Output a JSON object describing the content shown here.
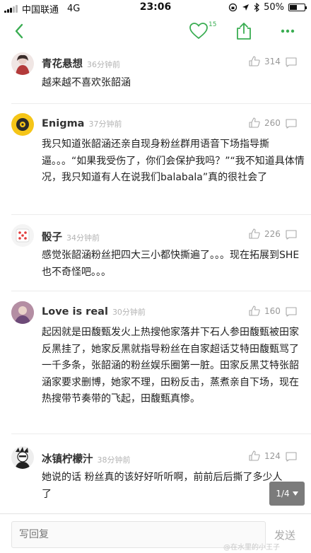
{
  "status": {
    "carrier": "中国联通",
    "network": "4G",
    "time": "23:06",
    "battery": "50%",
    "battery_level": 0.5
  },
  "nav": {
    "like_count": "15",
    "accent_color": "#3aad52"
  },
  "comments": [
    {
      "name": "青花悬想",
      "time": "36分钟前",
      "likes": "314",
      "text": "越来越不喜欢张韶涵"
    },
    {
      "name": "Enigma",
      "time": "37分钟前",
      "likes": "260",
      "text": "我只知道张韶涵还亲自现身粉丝群用语音下场指导撕逼。。。“如果我受伤了，你们会保护我吗？”“我不知道具体情况，我只知道有人在说我们balabala”真的很社会了"
    },
    {
      "name": "骰子",
      "time": "34分钟前",
      "likes": "226",
      "text": "感觉张韶涵粉丝把四大三小都快撕遍了。。。现在拓展到SHE 也不奇怪吧。。。"
    },
    {
      "name": "Love is real",
      "time": "30分钟前",
      "likes": "160",
      "text": "起因就是田馥甄发火上热搜他家落井下石人参田馥甄被田家反黑挂了，她家反黑就指导粉丝在自家超话艾特田馥甄骂了一千多条，张韶涵的粉丝娱乐圈第一脏。田家反黑艾特张韶涵家要求删博，她家不理，田粉反击，蒸煮亲自下场，现在热搜带节奏带的飞起，田馥甄真惨。"
    },
    {
      "name": "冰镇柠檬汁",
      "time": "38分钟前",
      "likes": "124",
      "text": "她说的话 粉丝真的该好好听听啊，前前后后撕了多少人了"
    }
  ],
  "pager": {
    "label": "1/4",
    "icon": "triangle-down-icon"
  },
  "bottom": {
    "placeholder": "写回复",
    "send_label": "发送",
    "watermark": "@在水里的小王子"
  }
}
